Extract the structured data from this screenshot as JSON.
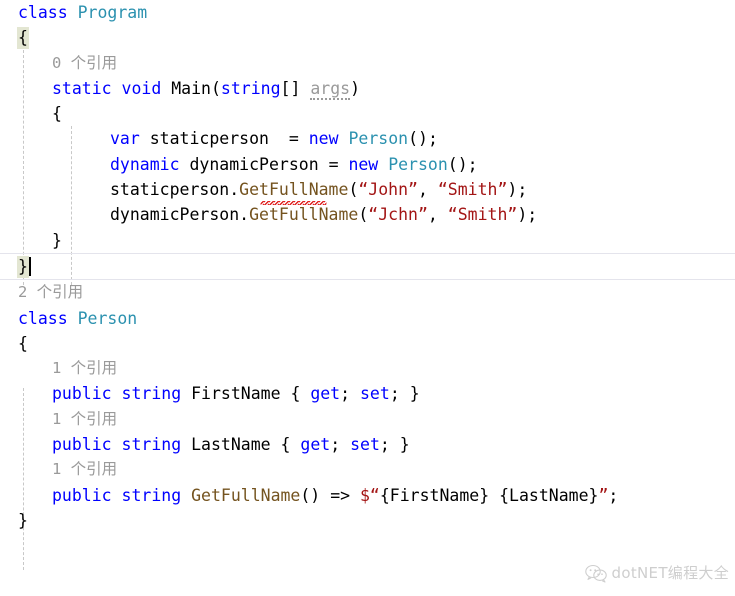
{
  "editor": {
    "language": "csharp",
    "theme": "visual-studio-light",
    "colors": {
      "keyword": "#0000FF",
      "type": "#2B91AF",
      "string": "#A31515",
      "method": "#74531F",
      "plain": "#000000",
      "codelens": "#9A9A9A",
      "brace_highlight": "#E3E6D2",
      "error_squiggle": "#E02020",
      "current_line_border": "#E4E4EC",
      "background": "#FFFFFF"
    }
  },
  "code": {
    "lines": [
      {
        "kind": "code",
        "indent": 0,
        "text": "class Program"
      },
      {
        "kind": "code",
        "indent": 0,
        "text": "{"
      },
      {
        "kind": "codelens",
        "indent": 1,
        "text": "0 个引用"
      },
      {
        "kind": "code",
        "indent": 1,
        "text": "static void Main(string[] args)"
      },
      {
        "kind": "code",
        "indent": 1,
        "text": "{"
      },
      {
        "kind": "code",
        "indent": 2,
        "text": "var staticperson  = new Person();"
      },
      {
        "kind": "code",
        "indent": 2,
        "text": "dynamic dynamicPerson = new Person();"
      },
      {
        "kind": "code",
        "indent": 2,
        "text": "staticperson.GetFullName(“John”, “Smith”);"
      },
      {
        "kind": "code",
        "indent": 2,
        "text": "dynamicPerson.GetFullName(“Jchn”, “Smith”);"
      },
      {
        "kind": "code",
        "indent": 1,
        "text": "}"
      },
      {
        "kind": "code",
        "indent": 0,
        "text": "}",
        "current": true,
        "caret": true
      },
      {
        "kind": "codelens",
        "indent": 0,
        "text": "2 个引用"
      },
      {
        "kind": "code",
        "indent": 0,
        "text": "class Person"
      },
      {
        "kind": "code",
        "indent": 0,
        "text": "{"
      },
      {
        "kind": "codelens",
        "indent": 1,
        "text": "1 个引用"
      },
      {
        "kind": "code",
        "indent": 1,
        "text": "public string FirstName { get; set; }"
      },
      {
        "kind": "codelens",
        "indent": 1,
        "text": "1 个引用"
      },
      {
        "kind": "code",
        "indent": 1,
        "text": "public string LastName { get; set; }"
      },
      {
        "kind": "codelens",
        "indent": 1,
        "text": "1 个引用"
      },
      {
        "kind": "code",
        "indent": 1,
        "text": "public string GetFullName() => $“{FirstName} {LastName}”;"
      },
      {
        "kind": "code",
        "indent": 0,
        "text": "}"
      }
    ],
    "codelens_labels": {
      "zero_refs": "0 个引用",
      "two_refs": "2 个引用",
      "one_ref": "1 个引用"
    },
    "diagnostics": [
      {
        "line": 7,
        "token": "GetFullName",
        "style": "red-wavy-underline"
      },
      {
        "line": 3,
        "token": "args",
        "style": "gray-dotted-underline"
      }
    ]
  },
  "line1": {
    "kw_class": "class",
    "type_program": "Program"
  },
  "line2": {
    "brace": "{"
  },
  "line3": {
    "codelens": "0 个引用"
  },
  "line4": {
    "kw_static": "static",
    "kw_void": "void",
    "meth_main": "Main",
    "paren_open": "(",
    "kw_string": "string",
    "brackets": "[]",
    "param_args": "args",
    "paren_close": ")"
  },
  "line5": {
    "brace": "{"
  },
  "line6": {
    "kw_var": "var",
    "ident": "staticperson",
    "eq": "=",
    "kw_new": "new",
    "type_person": "Person",
    "tail": "();"
  },
  "line7": {
    "kw_dynamic": "dynamic",
    "ident": "dynamicPerson",
    "eq": "=",
    "kw_new": "new",
    "type_person": "Person",
    "tail": "();"
  },
  "line8": {
    "ident": "staticperson",
    "dot": ".",
    "meth": "GetFullName",
    "paren_open": "(",
    "arg1": "“John”",
    "comma": ", ",
    "arg2": "“Smith”",
    "tail": ");"
  },
  "line9": {
    "ident": "dynamicPerson",
    "dot": ".",
    "meth": "GetFullName",
    "paren_open": "(",
    "arg1": "“Jchn”",
    "comma": ", ",
    "arg2": "“Smith”",
    "tail": ");"
  },
  "line10": {
    "brace": "}"
  },
  "line11": {
    "brace": "}"
  },
  "line12": {
    "codelens": "2 个引用"
  },
  "line13": {
    "kw_class": "class",
    "type_person": "Person"
  },
  "line14": {
    "brace": "{"
  },
  "line15": {
    "codelens": "1 个引用"
  },
  "line16": {
    "kw_public": "public",
    "kw_string": "string",
    "name": "FirstName",
    "open": "{ ",
    "kw_get": "get",
    "semi1": "; ",
    "kw_set": "set",
    "semi2": "; ",
    "close": "}"
  },
  "line17": {
    "codelens": "1 个引用"
  },
  "line18": {
    "kw_public": "public",
    "kw_string": "string",
    "name": "LastName",
    "open": "{ ",
    "kw_get": "get",
    "semi1": "; ",
    "kw_set": "set",
    "semi2": "; ",
    "close": "}"
  },
  "line19": {
    "codelens": "1 个引用"
  },
  "line20": {
    "kw_public": "public",
    "kw_string": "string",
    "meth": "GetFullName",
    "parens": "()",
    "arrow": "=>",
    "dollar_quote": "$“",
    "interp1": "{FirstName}",
    "space": " ",
    "interp2": "{LastName}",
    "end_quote": "”",
    "semi": ";"
  },
  "line21": {
    "brace": "}"
  },
  "watermark": {
    "text": "dotNET编程大全",
    "icon": "wechat-icon"
  }
}
